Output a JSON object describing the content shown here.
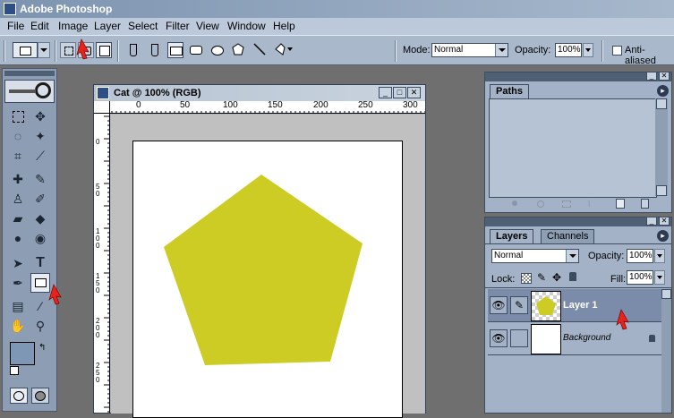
{
  "app": {
    "title": "Adobe Photoshop"
  },
  "menu": [
    "File",
    "Edit",
    "Image",
    "Layer",
    "Select",
    "Filter",
    "View",
    "Window",
    "Help"
  ],
  "options": {
    "mode_label": "Mode:",
    "mode_value": "Normal",
    "opacity_label": "Opacity:",
    "opacity_value": "100%",
    "antialias_label": "Anti-aliased"
  },
  "toolbox": {
    "type_tool": "T"
  },
  "document": {
    "title": "Cat @ 100% (RGB)",
    "ruler_h": [
      "0",
      "50",
      "100",
      "150",
      "200",
      "250",
      "300"
    ],
    "ruler_v": [
      "0",
      "5 0",
      "1 0 0",
      "1 5 0",
      "2 0 0",
      "2 5 0"
    ],
    "shape_color": "#cdcc24"
  },
  "paths_panel": {
    "tab": "Paths"
  },
  "layers_panel": {
    "tabs": [
      "Layers",
      "Channels"
    ],
    "blend_mode": "Normal",
    "opacity_label": "Opacity:",
    "opacity_value": "100%",
    "lock_label": "Lock:",
    "fill_label": "Fill:",
    "fill_value": "100%",
    "layers": [
      {
        "name": "Layer 1"
      },
      {
        "name": "Background"
      }
    ]
  },
  "colors": {
    "title_bar": "#7d94b0",
    "panel_bg": "#a3b2c6",
    "highlight": "#7b8cab",
    "arrow": "#e8231c"
  }
}
